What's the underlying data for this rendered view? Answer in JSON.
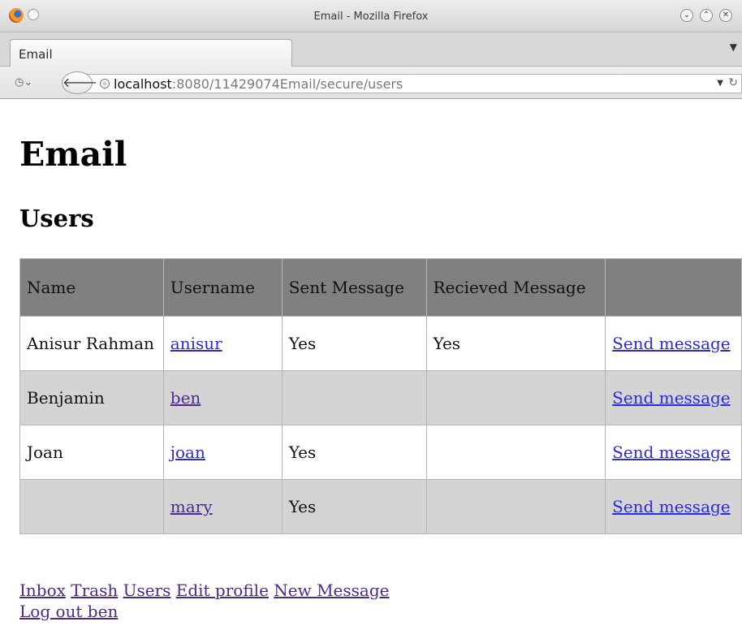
{
  "window": {
    "title": "Email - Mozilla Firefox",
    "controls": [
      "minimize",
      "maximize",
      "close"
    ]
  },
  "tabs": [
    {
      "label": "Email",
      "active": true
    }
  ],
  "navbar": {
    "url_host": "localhost",
    "url_rest": ":8080/11429074Email/secure/users"
  },
  "page": {
    "heading": "Email",
    "subheading": "Users"
  },
  "table": {
    "headers": [
      "Name",
      "Username",
      "Sent Message",
      "Recieved Message",
      ""
    ],
    "rows": [
      {
        "name": "Anisur Rahman",
        "username": "anisur",
        "sent": "Yes",
        "received": "Yes",
        "action": "Send message"
      },
      {
        "name": "Benjamin",
        "username": "ben",
        "sent": "",
        "received": "",
        "action": "Send message"
      },
      {
        "name": "Joan",
        "username": "joan",
        "sent": "Yes",
        "received": "",
        "action": "Send message"
      },
      {
        "name": "",
        "username": "mary",
        "sent": "Yes",
        "received": "",
        "action": "Send message"
      }
    ]
  },
  "footer": {
    "links": [
      "Inbox",
      "Trash",
      "Users",
      "Edit profile",
      "New Message"
    ],
    "logout": "Log out ben"
  },
  "colors": {
    "header_bg": "#808080",
    "row_alt_bg": "#d4d4d4",
    "link": "#2a2adf",
    "visited_link": "#4b2a8c"
  }
}
